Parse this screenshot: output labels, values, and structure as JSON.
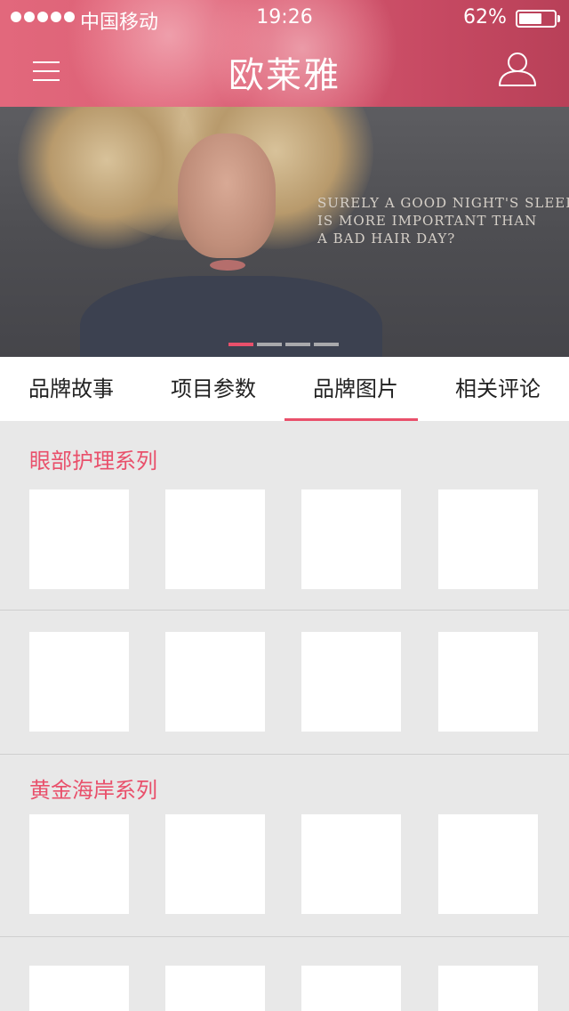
{
  "status_bar": {
    "carrier": "中国移动",
    "time": "19:26",
    "battery_percent": "62%",
    "battery_level": 0.62
  },
  "header": {
    "title": "欧莱雅",
    "menu_icon": "hamburger-menu-icon",
    "user_icon": "user-profile-icon",
    "color": "#d85c72"
  },
  "banner": {
    "quote_lines": [
      "SURELY A GOOD NIGHT'S SLEEP",
      "IS MORE IMPORTANT THAN",
      "A BAD HAIR DAY?"
    ],
    "slide_count": 4,
    "active_slide": 1
  },
  "tabs": [
    {
      "label": "品牌故事",
      "active": false
    },
    {
      "label": "项目参数",
      "active": false
    },
    {
      "label": "品牌图片",
      "active": true
    },
    {
      "label": "相关评论",
      "active": false
    }
  ],
  "sections": [
    {
      "title": "眼部护理系列",
      "rows": 2,
      "items_per_row": 4
    },
    {
      "title": "黄金海岸系列",
      "rows": 2,
      "items_per_row": 4
    }
  ],
  "accent_color": "#e9506b"
}
